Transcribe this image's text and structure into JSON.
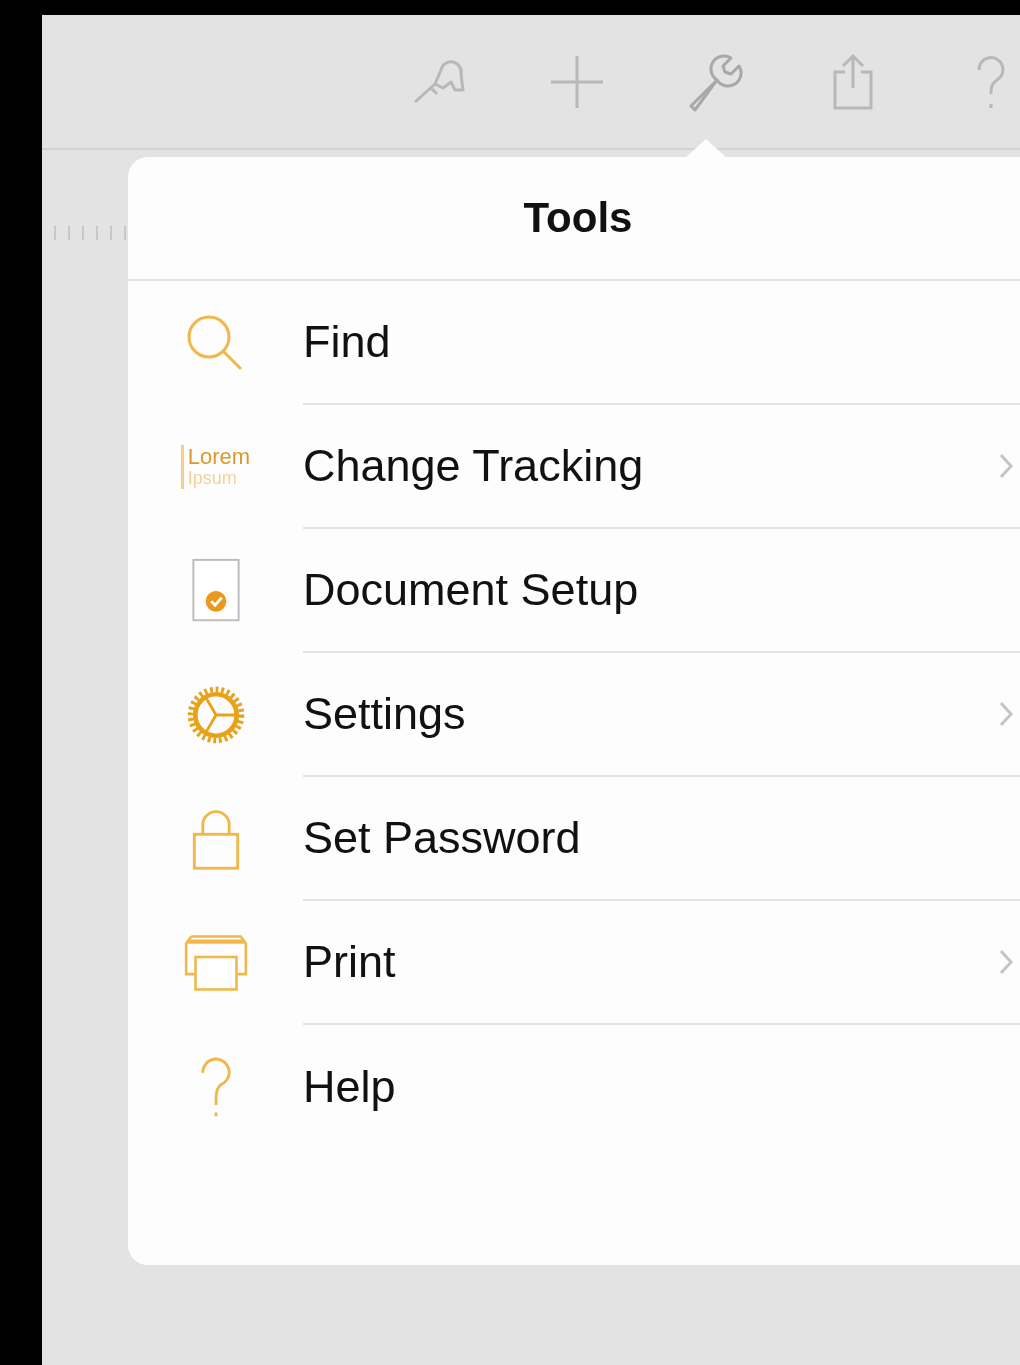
{
  "toolbar": {
    "buttons": [
      {
        "kind": "brush",
        "selected": false
      },
      {
        "kind": "plus",
        "selected": false
      },
      {
        "kind": "wrench",
        "selected": true
      },
      {
        "kind": "share",
        "selected": false
      },
      {
        "kind": "help",
        "selected": false
      }
    ]
  },
  "popover": {
    "title": "Tools",
    "items": [
      {
        "kind": "search",
        "label": "Find",
        "chevron": false
      },
      {
        "kind": "text-sample",
        "label": "Change Tracking",
        "chevron": true,
        "icon_lines": [
          "Lorem",
          "Ipsum"
        ]
      },
      {
        "kind": "document",
        "label": "Document Setup",
        "chevron": false
      },
      {
        "kind": "gear",
        "label": "Settings",
        "chevron": true
      },
      {
        "kind": "lock",
        "label": "Set Password",
        "chevron": false
      },
      {
        "kind": "printer",
        "label": "Print",
        "chevron": true
      },
      {
        "kind": "question",
        "label": "Help",
        "chevron": false
      }
    ]
  }
}
